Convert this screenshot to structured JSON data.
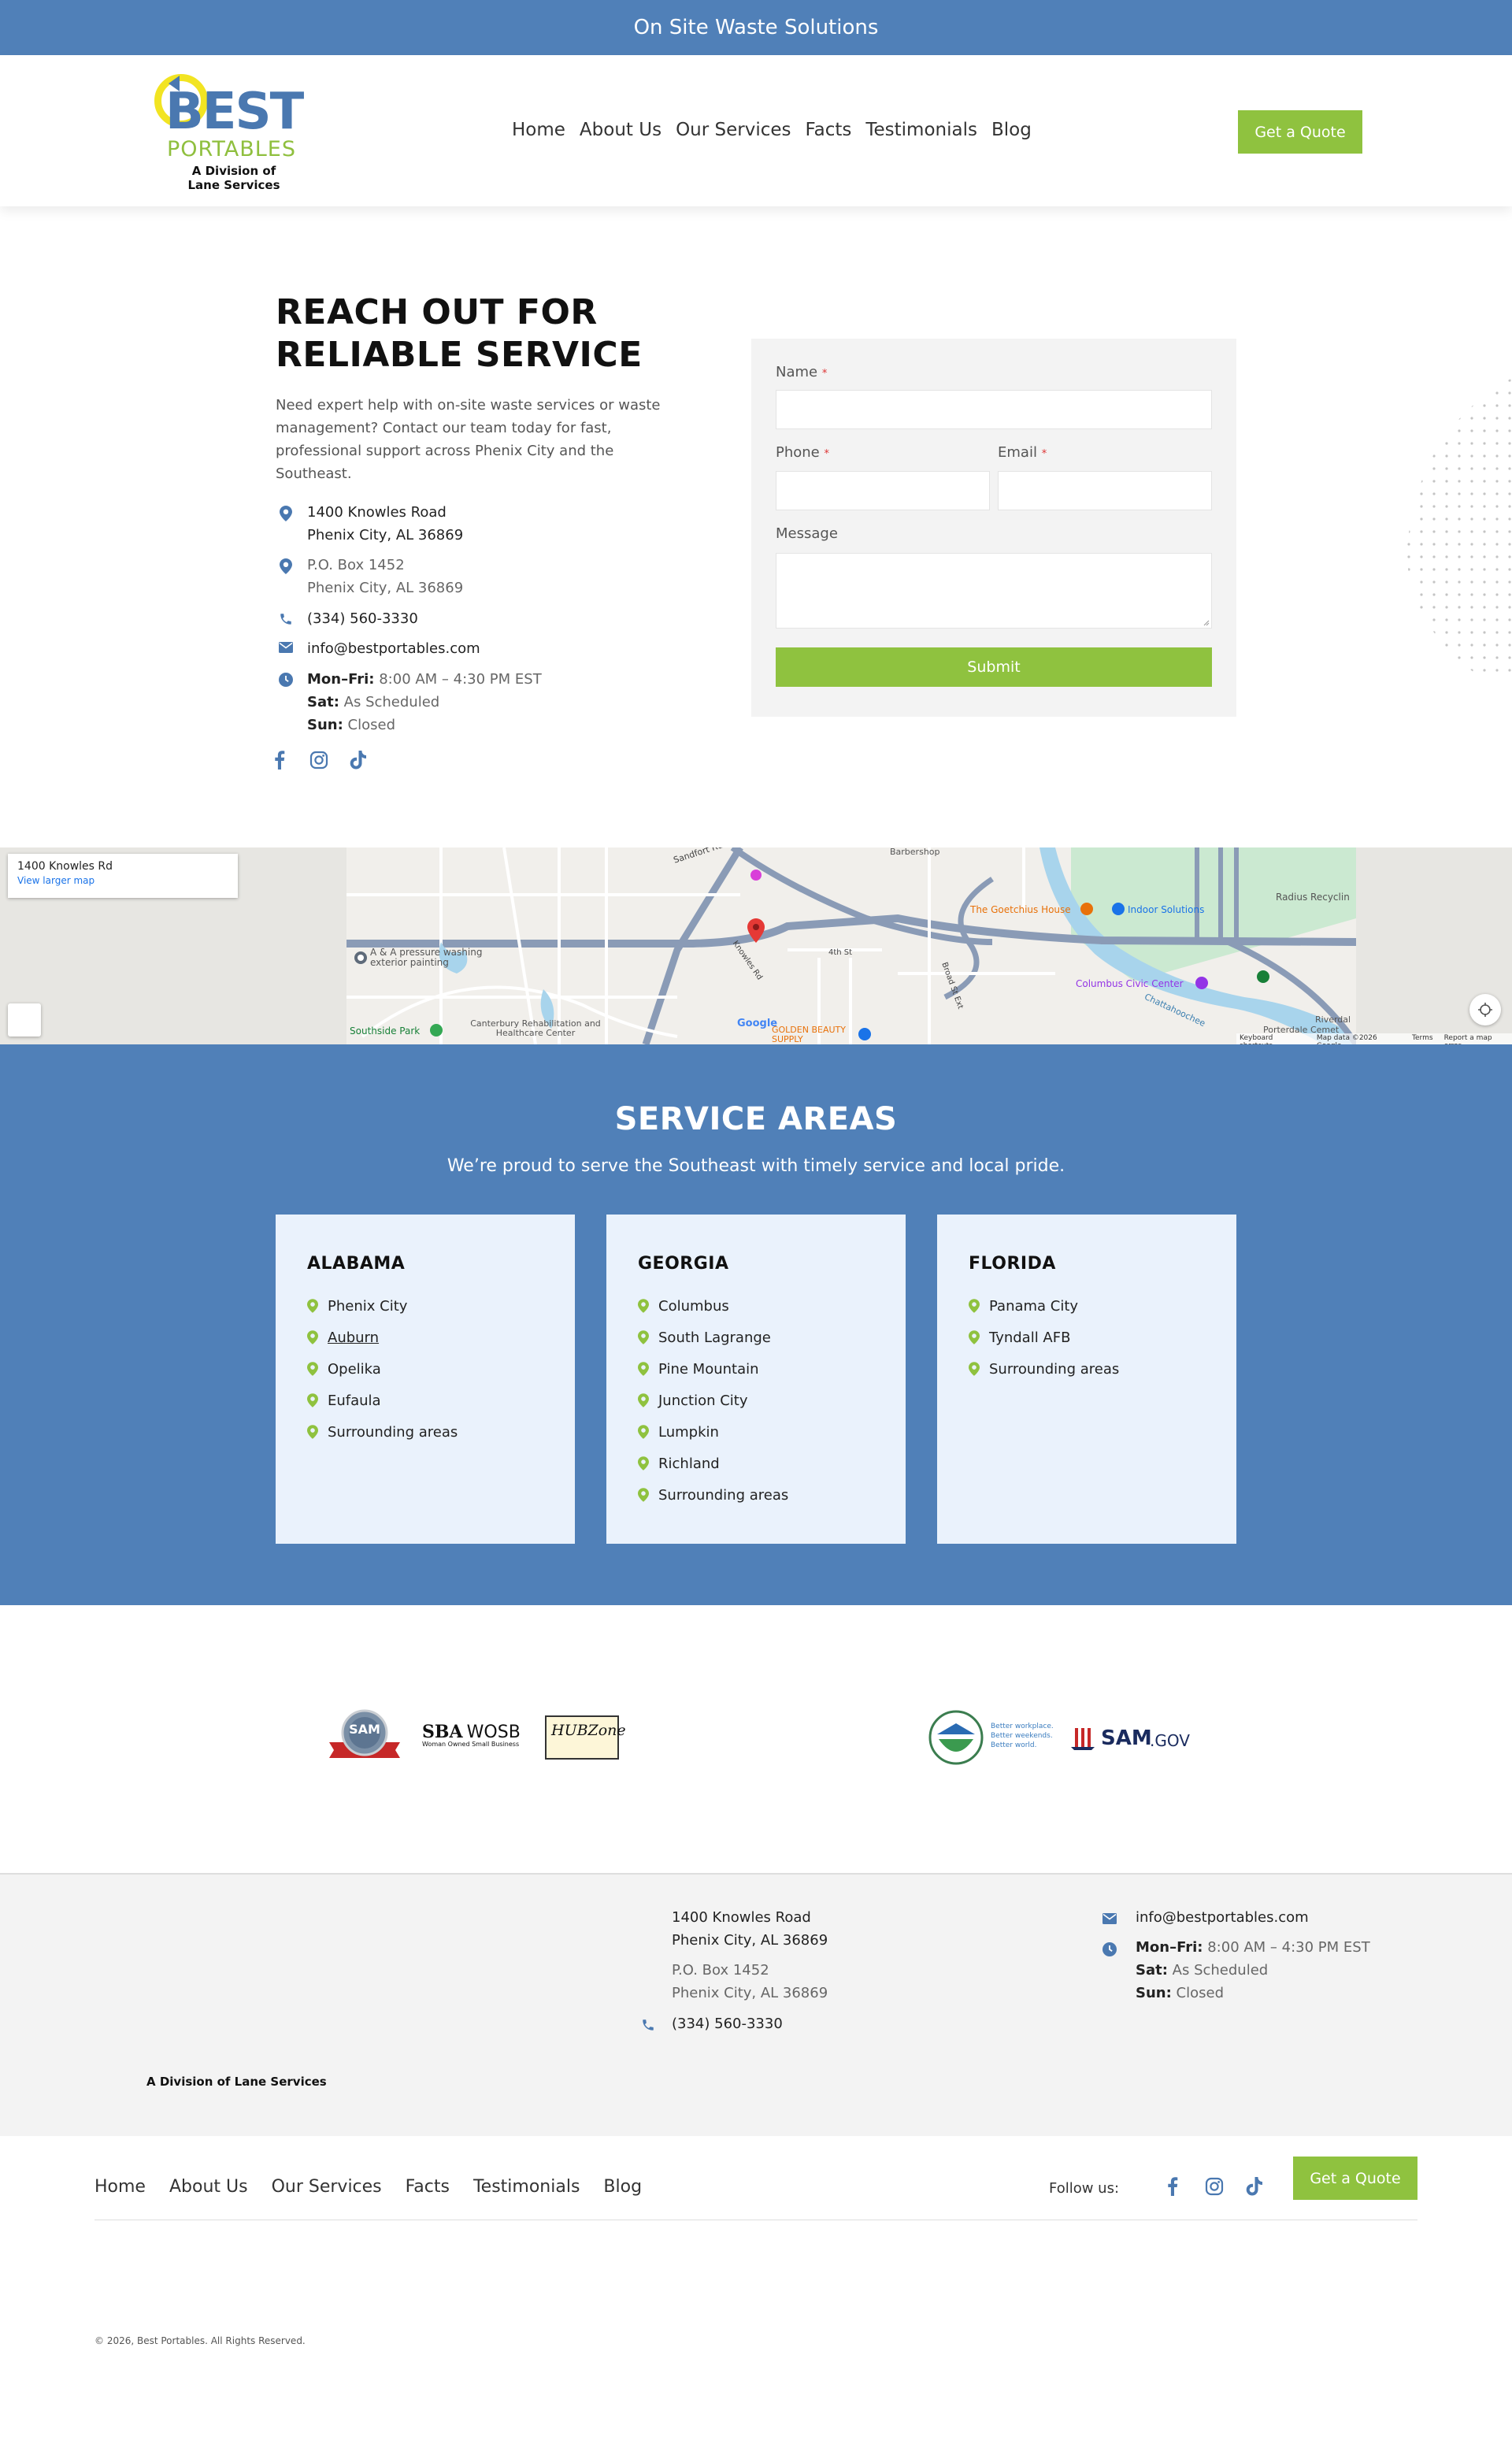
{
  "topbar": {
    "text": "On Site Waste Solutions"
  },
  "header": {
    "logo": {
      "best": "BEST",
      "portables": "PORTABLES",
      "division": "A Division of Lane Services"
    },
    "nav": [
      "Home",
      "About Us",
      "Our Services",
      "Facts",
      "Testimonials",
      "Blog"
    ],
    "quote_label": "Get a Quote"
  },
  "contact": {
    "title": "REACH OUT FOR RELIABLE SERVICE",
    "intro": "Need expert help with on-site waste services or waste management? Contact our team today for fast, professional support across Phenix City and the Southeast.",
    "address1": {
      "line1": "1400 Knowles Road",
      "line2": "Phenix City, AL 36869"
    },
    "address2": {
      "line1": "P.O. Box 1452",
      "line2": "Phenix City, AL 36869"
    },
    "phone": "(334) 560-3330",
    "email": "info@bestportables.com",
    "hours": {
      "weekday_label": "Mon–Fri:",
      "weekday_value": "8:00 AM – 4:30 PM EST",
      "sat_label": "Sat:",
      "sat_value": "As Scheduled",
      "sun_label": "Sun:",
      "sun_value": "Closed"
    }
  },
  "form": {
    "name_label": "Name",
    "phone_label": "Phone",
    "email_label": "Email",
    "message_label": "Message",
    "required_mark": "*",
    "submit_label": "Submit"
  },
  "map": {
    "place": "1400 Knowles Rd",
    "larger_link": "View larger map",
    "labels": {
      "sandfort": "Sandfort Rd",
      "barbershop": "Barbershop",
      "goetchius": "The Goetchius House",
      "indoor": "Indoor Solutions",
      "radius": "Radius Recyclin",
      "pressure": "A & A pressure washing exterior painting",
      "civic": "Columbus Civic Center",
      "canterbury": "Canterbury Rehabilitation and Healthcare Center",
      "southside": "Southside Park",
      "golden": "GOLDEN BEAUTY SUPPLY",
      "knowles": "Knowles Rd",
      "fourth": "4th St",
      "broad": "Broad St Ext",
      "chatt": "Chattahoochee",
      "porterdale": "Porterdale Cemet",
      "riverdale": "Riverdal",
      "google": "Google"
    },
    "footer": [
      "Keyboard shortcuts",
      "Map data ©2026 Google",
      "Terms",
      "Report a map error"
    ]
  },
  "service_areas": {
    "title": "SERVICE AREAS",
    "subtitle": "We’re proud to serve the Southeast with timely service and local pride.",
    "cards": [
      {
        "state": "ALABAMA",
        "cities": [
          "Phenix City",
          "Auburn",
          "Opelika",
          "Eufaula",
          "Surrounding areas"
        ]
      },
      {
        "state": "GEORGIA",
        "cities": [
          "Columbus",
          "South Lagrange",
          "Pine Mountain",
          "Junction City",
          "Lumpkin",
          "Richland",
          "Surrounding areas"
        ]
      },
      {
        "state": "FLORIDA",
        "cities": [
          "Panama City",
          "Tyndall AFB",
          "Surrounding areas"
        ]
      }
    ]
  },
  "badges": {
    "sam": "SAM",
    "sba": "SBA",
    "wosb": "WOSB",
    "wosb_sub": "Woman Owned Small Business",
    "hub": "HUBZone",
    "better1": "Better workplace.",
    "better2": "Better weekends.",
    "better3": "Better world.",
    "samgov_sam": "SAM",
    "samgov_gov": ".GOV"
  },
  "footer": {
    "division": "A Division of Lane Services",
    "address1": {
      "line1": "1400 Knowles Road",
      "line2": "Phenix City, AL 36869"
    },
    "address2": {
      "line1": "P.O. Box 1452",
      "line2": "Phenix City, AL 36869"
    },
    "phone": "(334) 560-3330",
    "email": "info@bestportables.com",
    "hours": {
      "weekday_label": "Mon–Fri:",
      "weekday_value": "8:00 AM – 4:30 PM EST",
      "sat_label": "Sat:",
      "sat_value": "As Scheduled",
      "sun_label": "Sun:",
      "sun_value": "Closed"
    },
    "nav": [
      "Home",
      "About Us",
      "Our Services",
      "Facts",
      "Testimonials",
      "Blog"
    ],
    "follow_label": "Follow us:",
    "quote_label": "Get a Quote",
    "copyright": "© 2026, Best Portables. All Rights Reserved."
  },
  "colors": {
    "brand_blue": "#5080b8",
    "accent_green": "#8fc23f",
    "card_bg": "#eaf2fc",
    "footer_bg": "#f3f3f3"
  }
}
